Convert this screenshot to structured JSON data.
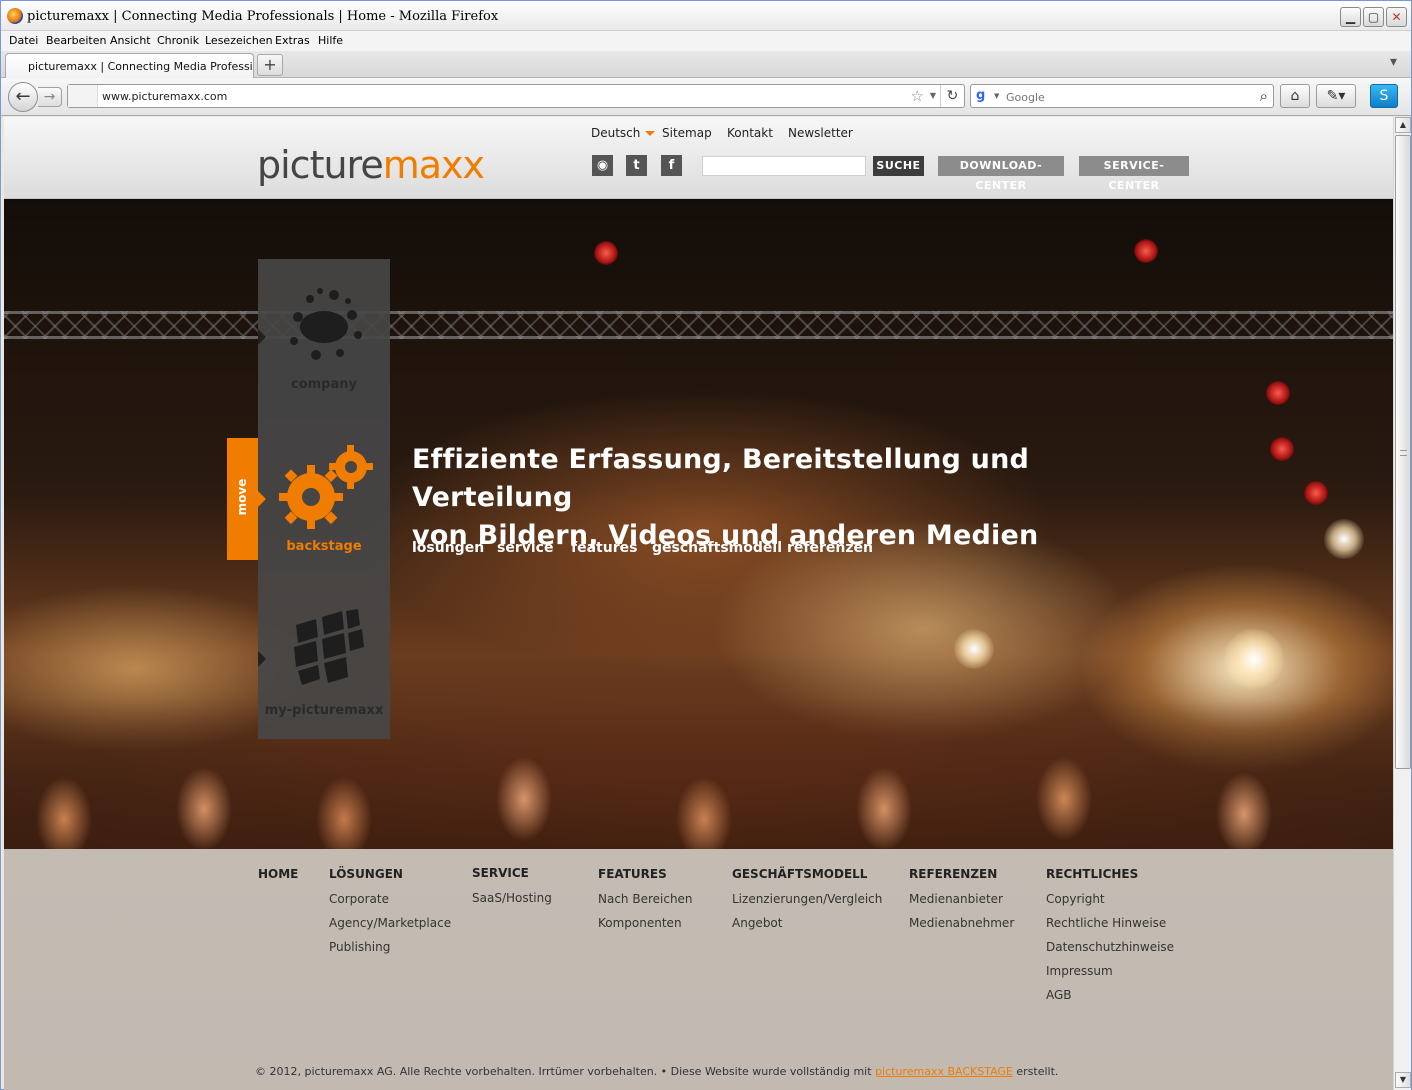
{
  "browser": {
    "window_title": "picturemaxx | Connecting Media Professionals | Home - Mozilla Firefox",
    "menu": [
      "Datei",
      "Bearbeiten",
      "Ansicht",
      "Chronik",
      "Lesezeichen",
      "Extras",
      "Hilfe"
    ],
    "tab_title": "picturemaxx | Connecting Media Professiona...",
    "new_tab": "+",
    "url": "www.picturemaxx.com",
    "search_placeholder": "Google"
  },
  "site": {
    "logo_part1": "picture",
    "logo_part2": "maxx",
    "topnav": {
      "language": "Deutsch",
      "sitemap": "Sitemap",
      "kontakt": "Kontakt",
      "newsletter": "Newsletter"
    },
    "search_button": "SUCHE",
    "download_center": "DOWNLOAD-CENTER",
    "service_center": "SERVICE-CENTER"
  },
  "hero": {
    "panel": {
      "company": "company",
      "backstage": "backstage",
      "my": "my-picturemaxx",
      "move": "move"
    },
    "headline_line1": "Effiziente Erfassung, Bereitstellung und Verteilung",
    "headline_line2": "von Bildern, Videos und anderen Medien",
    "subnav": [
      "lösungen",
      "service",
      "features",
      "geschäftsmodell",
      "referenzen"
    ]
  },
  "footer": {
    "columns": [
      {
        "heading": "HOME",
        "links": []
      },
      {
        "heading": "LÖSUNGEN",
        "links": [
          "Corporate",
          "Agency/Marketplace",
          "Publishing"
        ]
      },
      {
        "heading": "SERVICE",
        "links": [
          "SaaS/Hosting"
        ]
      },
      {
        "heading": "FEATURES",
        "links": [
          "Nach Bereichen",
          "Komponenten"
        ]
      },
      {
        "heading": "GESCHÄFTSMODELL",
        "links": [
          "Lizenzierungen/Vergleich",
          "Angebot"
        ]
      },
      {
        "heading": "REFERENZEN",
        "links": [
          "Medienanbieter",
          "Medienabnehmer"
        ]
      },
      {
        "heading": "RECHTLICHES",
        "links": [
          "Copyright",
          "Rechtliche Hinweise",
          "Datenschutzhinweise",
          "Impressum",
          "AGB"
        ]
      }
    ],
    "copyright_text": "© 2012, picturemaxx AG. Alle Rechte vorbehalten. Irrtümer vorbehalten.  •   Diese Website wurde vollständig mit",
    "copyright_link": "picturemaxx BACKSTAGE",
    "copyright_end": "erstellt."
  },
  "colors": {
    "accent": "#f07d00",
    "panel": "#464646",
    "header_bg": "#e8e8e8"
  }
}
